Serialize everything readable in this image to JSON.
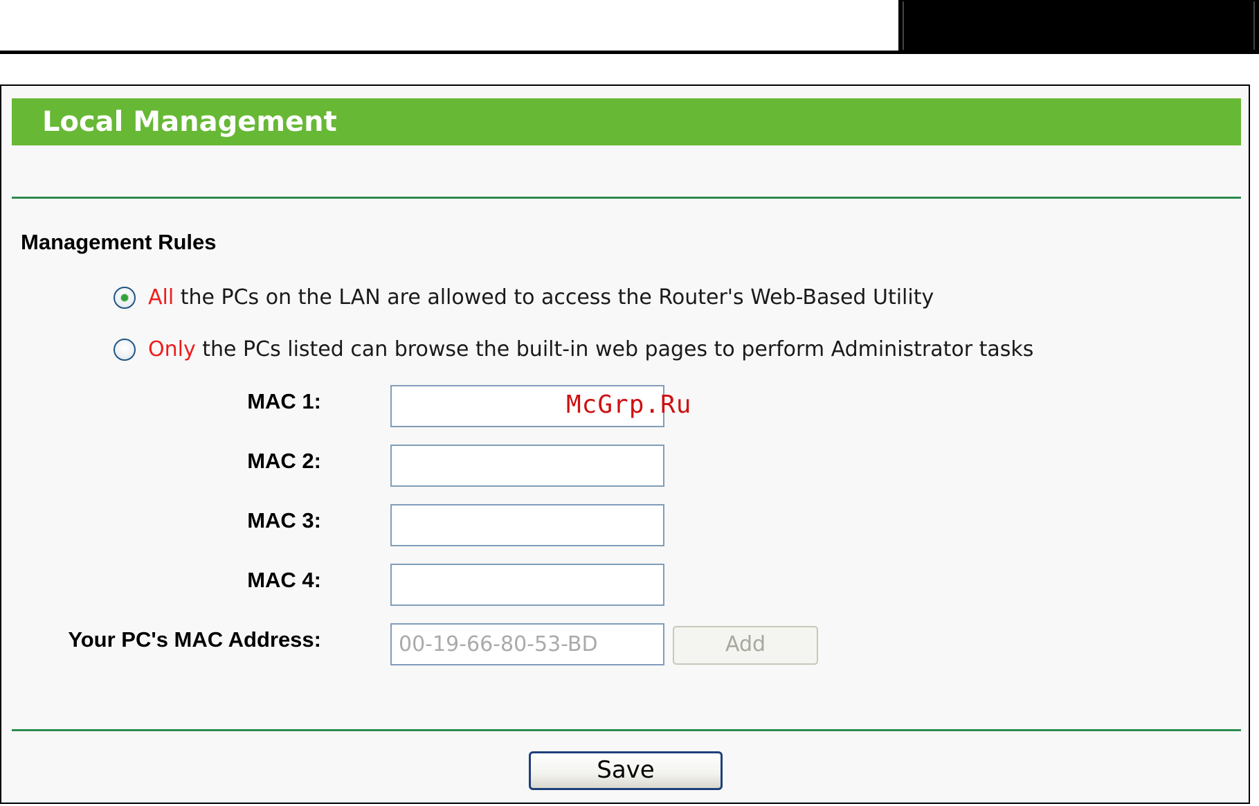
{
  "page": {
    "title": "Local Management",
    "section_title": "Management Rules"
  },
  "rules": {
    "option_all": {
      "emphasis": "All",
      "text": " the PCs on the LAN are allowed to access the Router's Web-Based Utility",
      "checked": true
    },
    "option_only": {
      "emphasis": "Only",
      "text": " the PCs listed can browse the built-in web pages to perform Administrator tasks",
      "checked": false
    }
  },
  "mac_fields": [
    {
      "label": "MAC 1:",
      "value": ""
    },
    {
      "label": "MAC 2:",
      "value": ""
    },
    {
      "label": "MAC 3:",
      "value": ""
    },
    {
      "label": "MAC 4:",
      "value": ""
    }
  ],
  "your_mac": {
    "label": "Your PC's MAC Address:",
    "value": "00-19-66-80-53-BD"
  },
  "buttons": {
    "add_label": "Add",
    "save_label": "Save"
  },
  "watermark": "McGrp.Ru",
  "colors": {
    "title_bar": "#67b835",
    "divider": "#2d8a4e",
    "emphasis": "#ee1c1c"
  }
}
